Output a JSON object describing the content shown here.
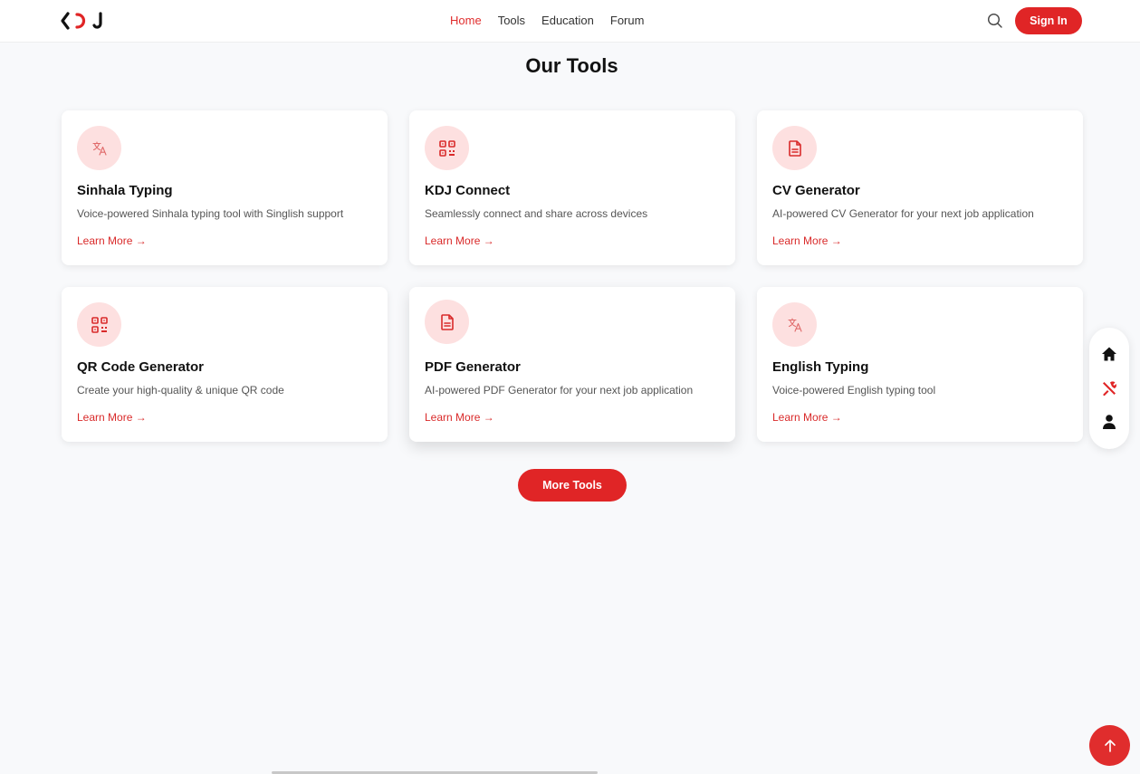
{
  "header": {
    "logo_text": "KDJ",
    "nav": [
      {
        "label": "Home",
        "active": true
      },
      {
        "label": "Tools",
        "active": false
      },
      {
        "label": "Education",
        "active": false
      },
      {
        "label": "Forum",
        "active": false
      }
    ],
    "search_icon": "search-icon",
    "signin_label": "Sign In"
  },
  "main": {
    "title": "Our Tools",
    "cards": [
      {
        "title": "Sinhala Typing",
        "desc": "Voice-powered Sinhala typing tool with Singlish support",
        "link": "Learn More →",
        "icon": "translate-icon"
      },
      {
        "title": "KDJ Connect",
        "desc": "Seamlessly connect and share across devices",
        "link": "Learn More →",
        "icon": "qr-code-icon"
      },
      {
        "title": "CV Generator",
        "desc": "AI-powered CV Generator for your next job application",
        "link": "Learn More →",
        "icon": "document-icon"
      },
      {
        "title": "QR Code Generator",
        "desc": "Create your high-quality & unique QR code",
        "link": "Learn More →",
        "icon": "qr-code-icon"
      },
      {
        "title": "PDF Generator",
        "desc": "AI-powered PDF Generator for your next job application",
        "link": "Learn More →",
        "icon": "document-icon"
      },
      {
        "title": "English Typing",
        "desc": "Voice-powered English typing tool",
        "link": "Learn More →",
        "icon": "translate-icon"
      }
    ],
    "more_button": "More Tools"
  },
  "dock": {
    "items": [
      "home-icon",
      "tools-icon",
      "user-icon"
    ]
  },
  "colors": {
    "accent": "#e02526",
    "icon_bg": "#fde0e0"
  }
}
